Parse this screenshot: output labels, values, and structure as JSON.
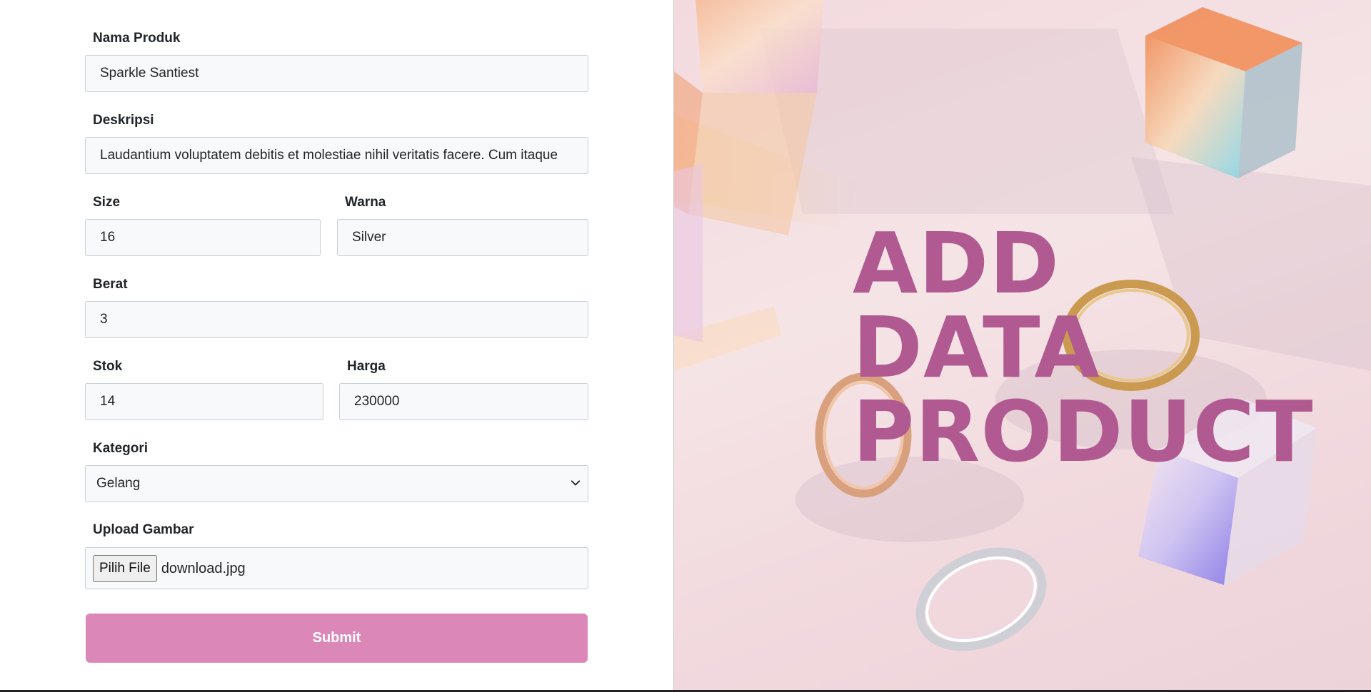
{
  "form": {
    "nama_produk": {
      "label": "Nama Produk",
      "value": "Sparkle Santiest"
    },
    "deskripsi": {
      "label": "Deskripsi",
      "value": "Laudantium voluptatem debitis et molestiae nihil veritatis facere. Cum itaque"
    },
    "size": {
      "label": "Size",
      "value": "16"
    },
    "warna": {
      "label": "Warna",
      "value": "Silver"
    },
    "berat": {
      "label": "Berat",
      "value": "3"
    },
    "stok": {
      "label": "Stok",
      "value": "14"
    },
    "harga": {
      "label": "Harga",
      "value": "230000"
    },
    "kategori": {
      "label": "Kategori",
      "selected": "Gelang"
    },
    "upload": {
      "label": "Upload Gambar",
      "button_label": "Pilih File",
      "file_name": "download.jpg"
    },
    "submit_label": "Submit"
  },
  "hero": {
    "title_lines": [
      "ADD",
      "DATA",
      "PRODUCT"
    ],
    "title_color": "#b05a91"
  },
  "colors": {
    "submit": "#db88b9",
    "input_bg": "#f8f9fa"
  },
  "icons": {
    "kategori_dropdown": "chevron-down-icon"
  }
}
